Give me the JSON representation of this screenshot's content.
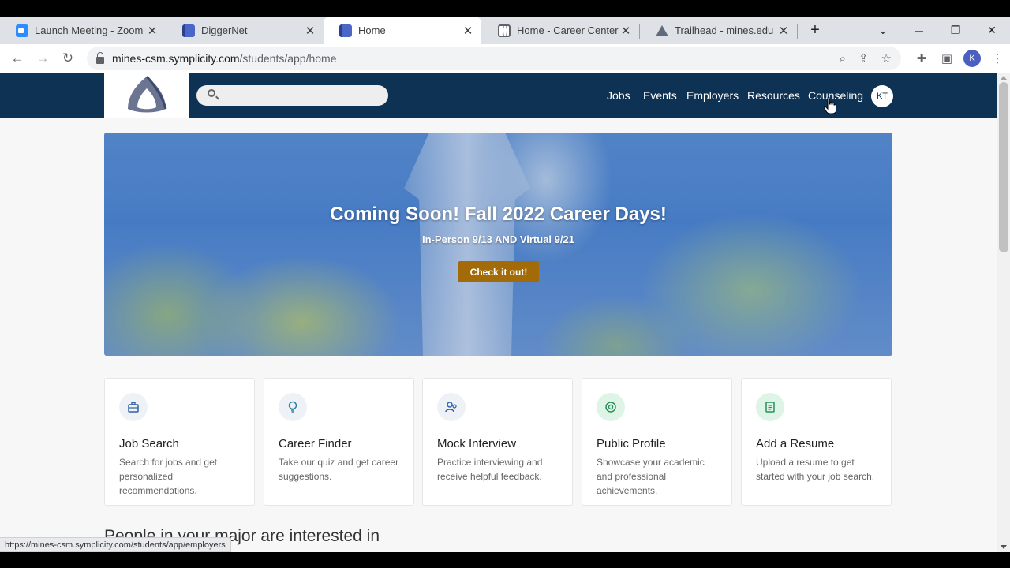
{
  "browser": {
    "tabs": [
      {
        "title": "Launch Meeting - Zoom",
        "icon": "zoom-icon",
        "active": false
      },
      {
        "title": "DiggerNet",
        "icon": "doc-icon",
        "active": false
      },
      {
        "title": "Home",
        "icon": "doc-icon",
        "active": true
      },
      {
        "title": "Home - Career Center",
        "icon": "globe-icon",
        "active": false
      },
      {
        "title": "Trailhead - mines.edu",
        "icon": "trailhead-icon",
        "active": false
      }
    ],
    "new_tab": "+",
    "url_host": "mines-csm.symplicity.com",
    "url_path": "/students/app/home",
    "profile_initial": "K",
    "status_url": "https://mines-csm.symplicity.com/students/app/employers"
  },
  "header": {
    "search_placeholder": "",
    "nav": [
      "Jobs",
      "Events",
      "Employers",
      "Resources",
      "Counseling"
    ],
    "avatar": "KT"
  },
  "hero": {
    "title": "Coming Soon! Fall 2022 Career Days!",
    "subtitle": "In-Person 9/13 AND Virtual 9/21",
    "button": "Check it out!"
  },
  "cards": [
    {
      "title": "Job Search",
      "desc": "Search for jobs and get personalized recommendations.",
      "icon": "briefcase-icon"
    },
    {
      "title": "Career Finder",
      "desc": "Take our quiz and get career suggestions.",
      "icon": "lightbulb-icon"
    },
    {
      "title": "Mock Interview",
      "desc": "Practice interviewing and receive helpful feedback.",
      "icon": "interview-icon"
    },
    {
      "title": "Public Profile",
      "desc": "Showcase your academic and professional achievements.",
      "icon": "at-sign-icon"
    },
    {
      "title": "Add a Resume",
      "desc": "Upload a resume to get started with your job search.",
      "icon": "document-icon"
    }
  ],
  "section_heading": "People in your major are interested in",
  "colors": {
    "header_bg": "#0e3253",
    "button_bg": "#a26b07"
  }
}
